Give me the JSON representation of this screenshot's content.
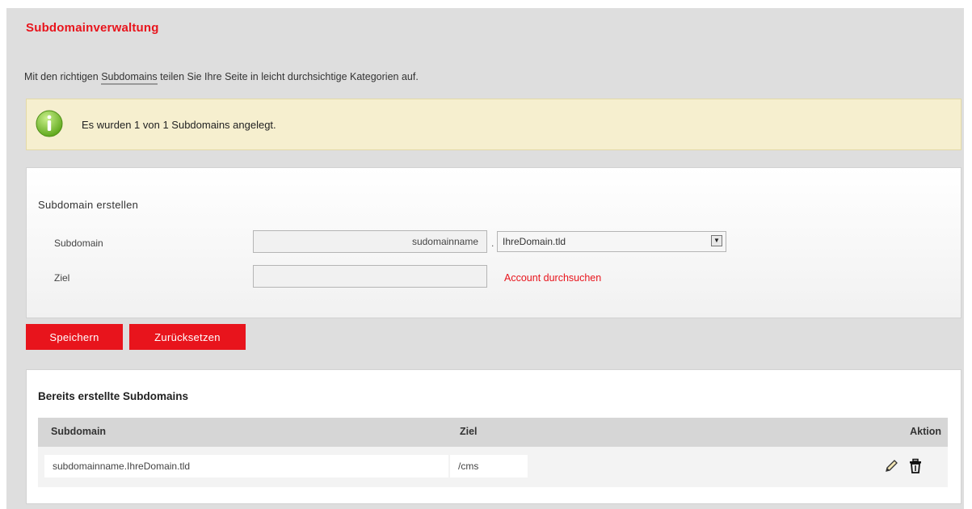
{
  "page": {
    "title": "Subdomainverwaltung",
    "intro_before": "Mit den richtigen ",
    "intro_link": "Subdomains",
    "intro_after": " teilen Sie Ihre Seite in leicht durchsichtige Kategorien auf."
  },
  "notice": {
    "icon": "info-icon",
    "message": "Es wurden 1 von 1 Subdomains angelegt."
  },
  "form": {
    "heading": "Subdomain erstellen",
    "subdomain_label": "Subdomain",
    "subdomain_value": "sudomainname",
    "separator": ".",
    "domain_select_value": "IhreDomain.tld",
    "target_label": "Ziel",
    "target_value": "",
    "account_link": "Account durchsuchen"
  },
  "buttons": {
    "save": "Speichern",
    "reset": "Zurücksetzen"
  },
  "list": {
    "heading": "Bereits erstellte Subdomains",
    "columns": [
      "Subdomain",
      "Ziel",
      "Aktion"
    ],
    "rows": [
      {
        "subdomain": "subdomainname.IhreDomain.tld",
        "target": "/cms",
        "actions": [
          "edit-icon",
          "delete-icon"
        ]
      }
    ]
  },
  "colors": {
    "accent": "#e8141c",
    "notice_bg": "#f6efcf",
    "page_bg": "#dedede"
  }
}
